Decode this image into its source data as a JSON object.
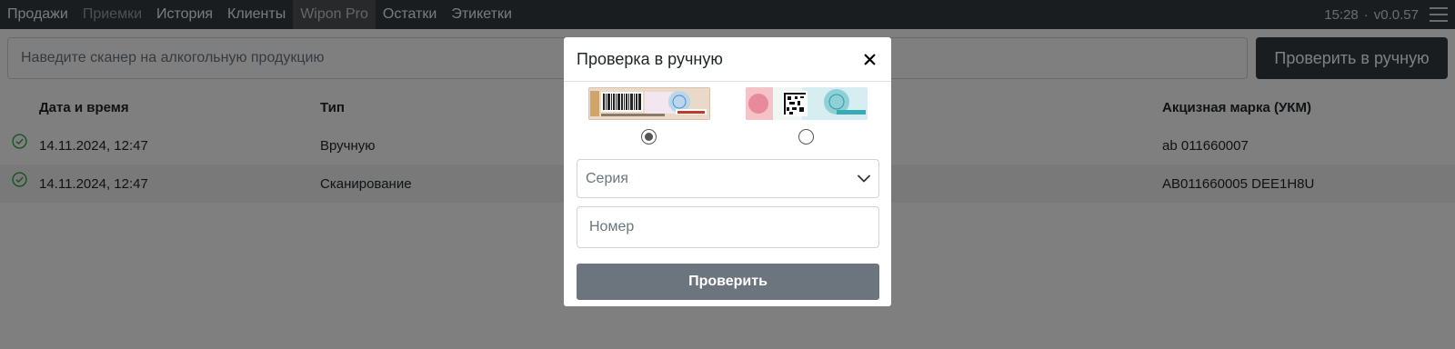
{
  "nav": {
    "items": [
      {
        "label": "Продажи",
        "state": "normal"
      },
      {
        "label": "Приемки",
        "state": "muted"
      },
      {
        "label": "История",
        "state": "normal"
      },
      {
        "label": "Клиенты",
        "state": "normal"
      },
      {
        "label": "Wipon Pro",
        "state": "active"
      },
      {
        "label": "Остатки",
        "state": "normal"
      },
      {
        "label": "Этикетки",
        "state": "normal"
      }
    ],
    "time": "15:28",
    "separator": "·",
    "version": "v0.0.57",
    "menu_icon": "hamburger-icon"
  },
  "search": {
    "placeholder": "Наведите сканер на алкогольную продукцию",
    "button_label": "Проверить в ручную"
  },
  "table": {
    "headers": {
      "date": "Дата и время",
      "type": "Тип",
      "mark": "Акцизная марка (УКМ)"
    },
    "rows": [
      {
        "date": "14.11.2024, 12:47",
        "type": "Вручную",
        "mark": "ab 011660007",
        "status_icon": "check-circle-icon"
      },
      {
        "date": "14.11.2024, 12:47",
        "type": "Сканирование",
        "mark": "AB011660005 DEE1H8U",
        "status_icon": "check-circle-icon"
      }
    ],
    "status_color": "#28a745"
  },
  "modal": {
    "title": "Проверка в ручную",
    "close_icon": "close-icon",
    "stamp_options": [
      {
        "name": "old-stamp",
        "selected": true
      },
      {
        "name": "new-stamp",
        "selected": false
      }
    ],
    "series_placeholder": "Серия",
    "number_placeholder": "Номер",
    "submit_label": "Проверить"
  },
  "colors": {
    "topbar": "#343a40",
    "overlay": "rgba(0,0,0,0.5)",
    "submit_button": "#6c757d"
  }
}
